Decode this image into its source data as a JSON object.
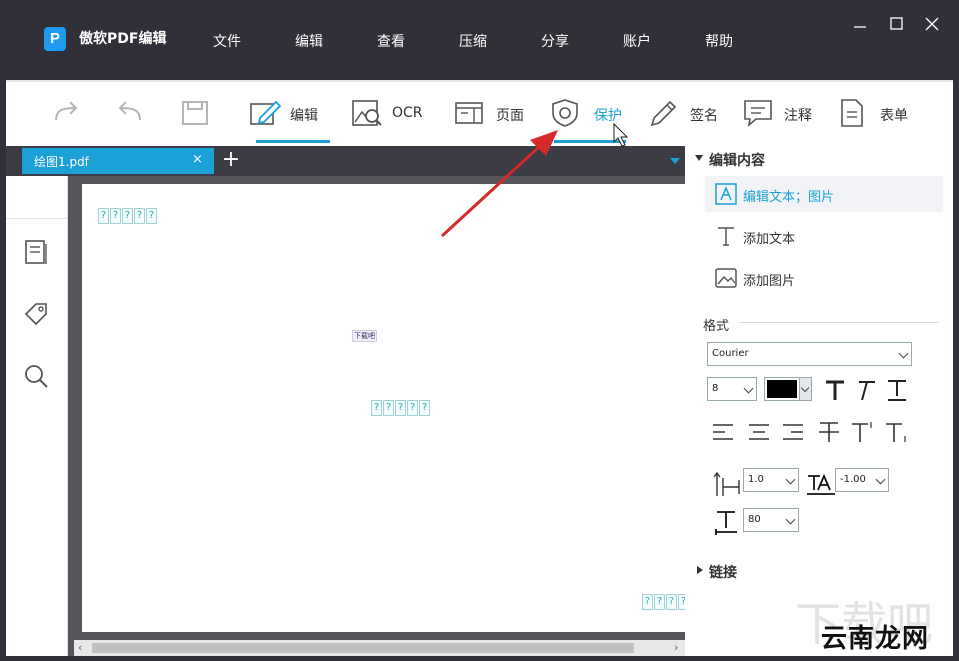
{
  "app": {
    "logo_letter": "P",
    "title": "傲软PDF编辑"
  },
  "menu": [
    "文件",
    "编辑",
    "查看",
    "压缩",
    "分享",
    "账户",
    "帮助"
  ],
  "window_controls": [
    "minimize-icon",
    "maximize-icon",
    "close-icon"
  ],
  "toolbar": {
    "edit": "编辑",
    "ocr": "OCR",
    "page": "页面",
    "protect": "保护",
    "sign": "签名",
    "annotate": "注释",
    "form": "表单",
    "active_tab": "编辑",
    "hovered_tab": "保护",
    "accent_color": "#1ba0d8"
  },
  "tabs": {
    "doc_title": "绘图1.pdf",
    "close_glyph": "×",
    "new_glyph": "+"
  },
  "document": {
    "glyph_char": "?",
    "glyph_block_top": "?????",
    "glyph_block_middle": "?????",
    "glyph_block_bottom": "????",
    "small_text": "下载吧"
  },
  "right_panel": {
    "section_edit": "编辑内容",
    "edit_text_image": "编辑文本；图片",
    "add_text": "添加文本",
    "add_image": "添加图片",
    "format_label": "格式",
    "font": "Courier",
    "font_size": "8",
    "text_color": "#000000",
    "line_spacing": "1.0",
    "char_spacing": "-1.00",
    "scale": "80",
    "section_link": "链接"
  },
  "watermark": {
    "bg_text": "下载吧",
    "text": "云南龙网"
  }
}
